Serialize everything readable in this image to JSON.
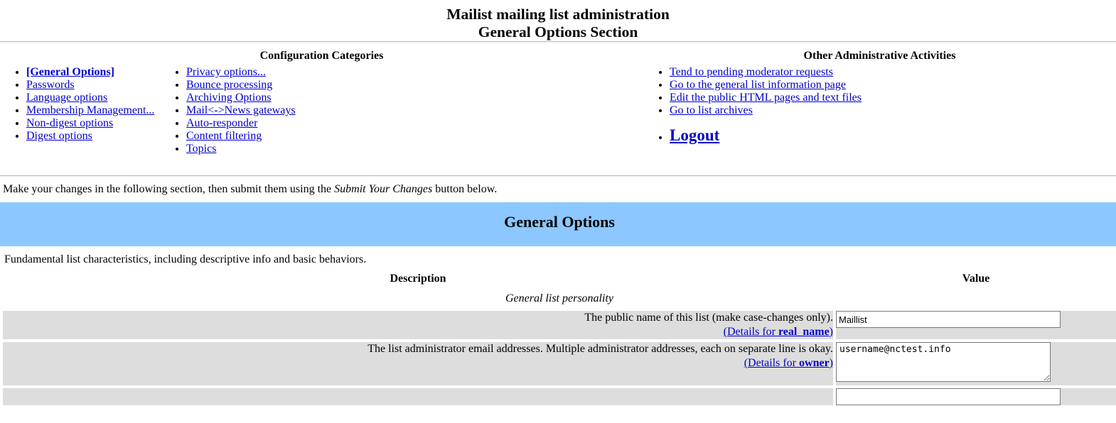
{
  "header": {
    "title_line1": "Mailist mailing list administration",
    "title_line2": "General Options Section"
  },
  "nav": {
    "config_heading": "Configuration Categories",
    "other_heading": "Other Administrative Activities",
    "config_column_left": [
      {
        "label": "[General Options]",
        "current": true
      },
      {
        "label": "Passwords",
        "current": false
      },
      {
        "label": "Language options",
        "current": false
      },
      {
        "label": "Membership Management...",
        "current": false
      },
      {
        "label": "Non-digest options",
        "current": false
      },
      {
        "label": "Digest options",
        "current": false
      }
    ],
    "config_column_right": [
      {
        "label": "Privacy options...",
        "current": false
      },
      {
        "label": "Bounce processing",
        "current": false
      },
      {
        "label": "Archiving Options",
        "current": false
      },
      {
        "label": "Mail<->News gateways",
        "current": false
      },
      {
        "label": "Auto-responder",
        "current": false
      },
      {
        "label": "Content filtering",
        "current": false
      },
      {
        "label": "Topics",
        "current": false
      }
    ],
    "other_activities": [
      "Tend to pending moderator requests",
      "Go to the general list information page",
      "Edit the public HTML pages and text files",
      "Go to list archives"
    ],
    "logout_label": "Logout"
  },
  "instructions": {
    "prefix": "Make your changes in the following section, then submit them using the ",
    "emphasis": "Submit Your Changes",
    "suffix": " button below."
  },
  "section": {
    "banner_title": "General Options",
    "banner_color": "#8cc8ff",
    "description": "Fundamental list characteristics, including descriptive info and basic behaviors."
  },
  "table": {
    "header_description": "Description",
    "header_value": "Value",
    "subsection_label": "General list personality",
    "row_background": "#dddddd",
    "rows": [
      {
        "description": "The public name of this list (make case-changes only).",
        "details_prefix": "(Details for ",
        "details_var": "real_name",
        "details_suffix": ")",
        "input_type": "text",
        "value": "Maillist"
      },
      {
        "description": "The list administrator email addresses. Multiple administrator addresses, each on separate line is okay.",
        "details_prefix": "(Details for ",
        "details_var": "owner",
        "details_suffix": ")",
        "input_type": "textarea",
        "value": "username@nctest.info"
      },
      {
        "description": "",
        "details_prefix": "",
        "details_var": "",
        "details_suffix": "",
        "input_type": "text",
        "value": ""
      }
    ]
  }
}
